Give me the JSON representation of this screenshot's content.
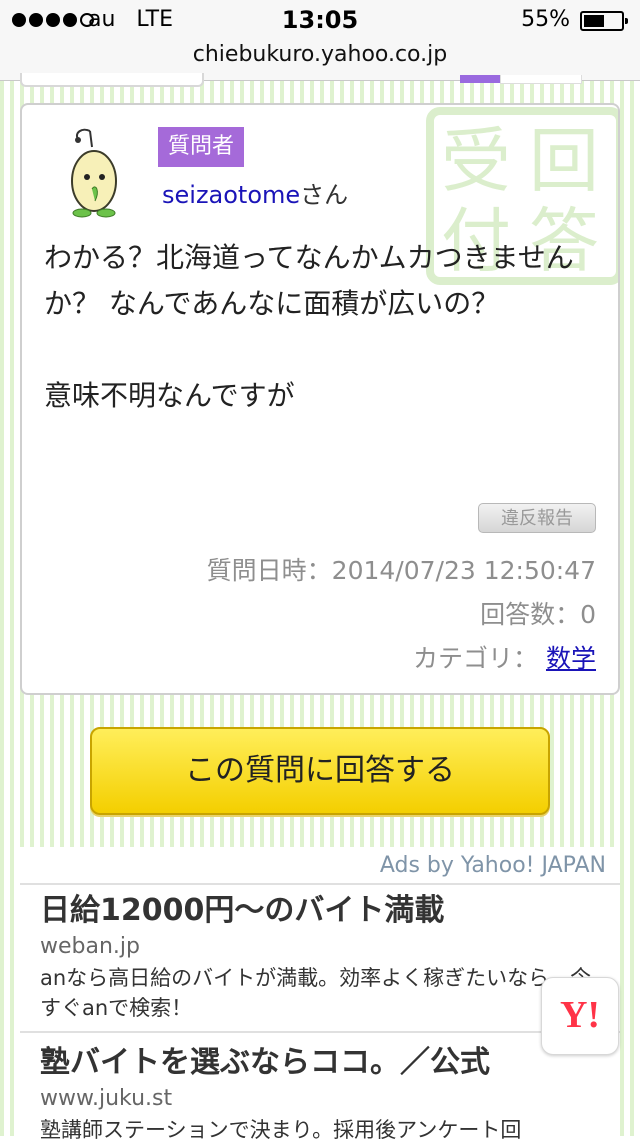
{
  "status_bar": {
    "carrier": "au",
    "network": "LTE",
    "time": "13:05",
    "battery_percent": "55%",
    "battery_level": 0.55,
    "signal_bars_filled": 4,
    "signal_bars_total": 5
  },
  "address_bar": {
    "url": "chiebukuro.yahoo.co.jp"
  },
  "question": {
    "asker_badge": "質問者",
    "asker_name": "seizaotome",
    "asker_suffix": "さん",
    "stamp_chars": [
      "受",
      "回",
      "付",
      "答"
    ],
    "body_line1": "わかる？北海道ってなんかムカつきませんか？ なんであんなに面積が広いの？",
    "body_line2": "意味不明なんですが",
    "report_label": "違反報告",
    "date_label": "質問日時：",
    "date_value": "2014/07/23 12:50:47",
    "answer_count_label": "回答数：",
    "answer_count": "0",
    "category_label": "カテゴリ：",
    "category_value": "数学"
  },
  "answer_button": {
    "label": "この質問に回答する"
  },
  "ads": {
    "header": "Ads by Yahoo! JAPAN",
    "items": [
      {
        "title": "日給12000円〜のバイト満載",
        "url": "weban.jp",
        "description": "anなら高日給のバイトが満載。効率よく稼ぎたいなら、今すぐanで検索！"
      },
      {
        "title": "塾バイトを選ぶならココ。／公式",
        "url": "www.juku.st",
        "description": "塾講師ステーションで決まり。採用後アンケート回"
      }
    ]
  },
  "yahoo_badge": {
    "label": "Y!"
  },
  "colors": {
    "badge_purple": "#a56ad9",
    "link_blue": "#1a14b8",
    "button_yellow": "#f4cf00",
    "stripe_green": "#dff2cf",
    "stamp_green": "#dbeecc"
  }
}
